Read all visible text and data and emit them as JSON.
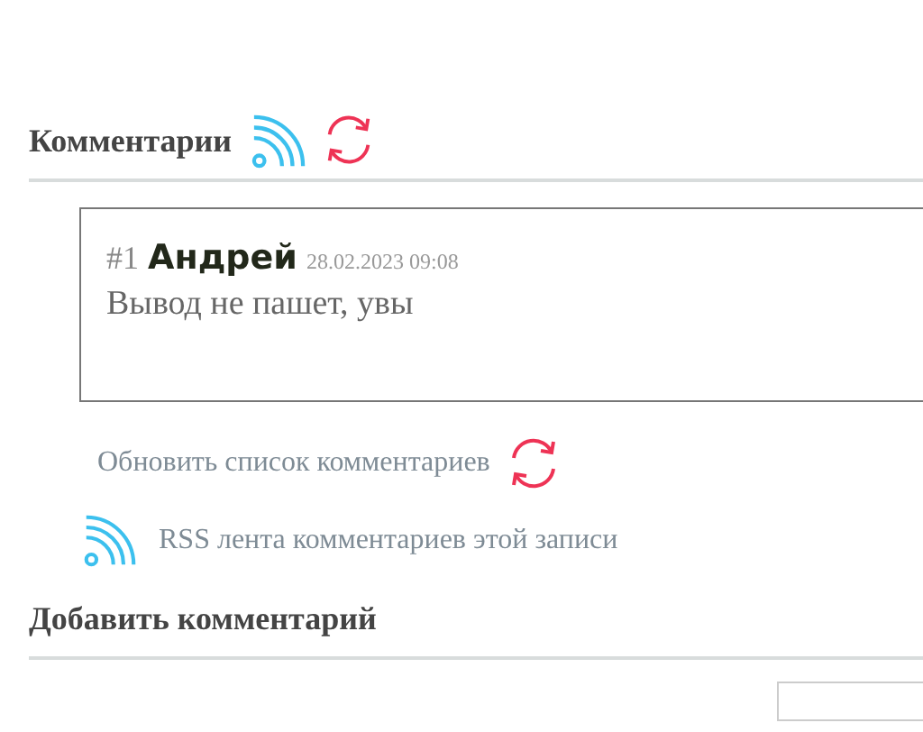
{
  "comments_heading": "Комментарии",
  "comments": [
    {
      "number": "#1",
      "author": "Андрей",
      "date": "28.02.2023 09:08",
      "text": "Вывод не пашет, увы"
    }
  ],
  "refresh_link": "Обновить список комментариев",
  "rss_link": "RSS лента комментариев этой записи",
  "add_heading": "Добавить комментарий"
}
